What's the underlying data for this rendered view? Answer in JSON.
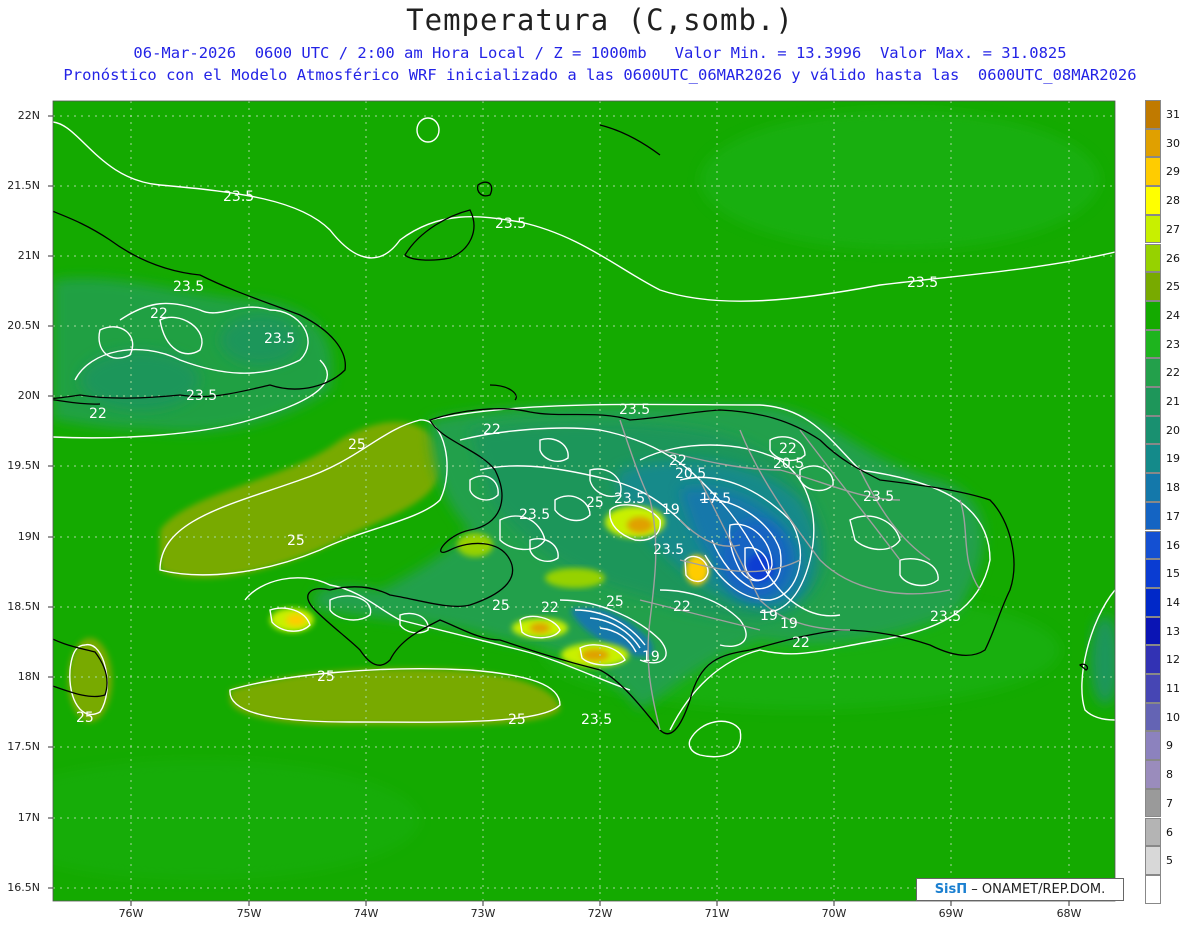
{
  "header": {
    "title": "Temperatura (C,somb.)",
    "line1": "06-Mar-2026  0600 UTC / 2:00 am Hora Local / Z = 1000mb   Valor Min. = 13.3996  Valor Max. = 31.0825",
    "line2": "Pronóstico con el Modelo Atmosférico WRF inicializado a las 0600UTC_06MAR2026 y válido hasta las  0600UTC_08MAR2026"
  },
  "axes": {
    "lat_labels": [
      "22N",
      "21.5N",
      "21N",
      "20.5N",
      "20N",
      "19.5N",
      "19N",
      "18.5N",
      "18N",
      "17.5N",
      "17N",
      "16.5N"
    ],
    "lon_labels": [
      "76W",
      "75W",
      "74W",
      "73W",
      "72W",
      "71W",
      "70W",
      "69W",
      "68W"
    ]
  },
  "colorbar": {
    "levels": [
      {
        "label": "31",
        "color": "#c07a00"
      },
      {
        "label": "30",
        "color": "#e0a000"
      },
      {
        "label": "29",
        "color": "#ffcc00"
      },
      {
        "label": "28",
        "color": "#ffff00"
      },
      {
        "label": "27",
        "color": "#c8f000"
      },
      {
        "label": "26",
        "color": "#96d200"
      },
      {
        "label": "25",
        "color": "#78aa00"
      },
      {
        "label": "24",
        "color": "#14aa00"
      },
      {
        "label": "23",
        "color": "#1eb41e"
      },
      {
        "label": "22",
        "color": "#23a04b"
      },
      {
        "label": "21",
        "color": "#1e965a"
      },
      {
        "label": "20",
        "color": "#199070"
      },
      {
        "label": "19",
        "color": "#148a8a"
      },
      {
        "label": "18",
        "color": "#1478aa"
      },
      {
        "label": "17",
        "color": "#1464c3"
      },
      {
        "label": "16",
        "color": "#1450d2"
      },
      {
        "label": "15",
        "color": "#0a3cd2"
      },
      {
        "label": "14",
        "color": "#0028c8"
      },
      {
        "label": "13",
        "color": "#0a14b4"
      },
      {
        "label": "12",
        "color": "#3232b4"
      },
      {
        "label": "11",
        "color": "#4646b4"
      },
      {
        "label": "10",
        "color": "#6464b4"
      },
      {
        "label": "9",
        "color": "#8c82be"
      },
      {
        "label": "8",
        "color": "#9a8cbc"
      },
      {
        "label": "7",
        "color": "#9a9a9a"
      },
      {
        "label": "6",
        "color": "#b4b4b4"
      },
      {
        "label": "5",
        "color": "#d8d8d8"
      },
      {
        "label": "",
        "color": "#ffffff"
      }
    ]
  },
  "contour_labels": [
    "23.5",
    "23.5",
    "23.5",
    "23.5",
    "22",
    "23.5",
    "22",
    "23.5",
    "22",
    "25",
    "25",
    "23.5",
    "22",
    "22",
    "20.5",
    "20.5",
    "25",
    "23.5",
    "17.5",
    "19",
    "23.5",
    "23.5",
    "25",
    "22",
    "25",
    "22",
    "19",
    "23.5",
    "19",
    "25",
    "25",
    "23.5",
    "25",
    "22",
    "19",
    "23.5"
  ],
  "credit": {
    "logo": "SisΠ",
    "text": "– ONAMET/REP.DOM."
  },
  "colors": {
    "ocean": "#14aa00",
    "land_high": "#78aa00",
    "hot": "#ffcc00",
    "cold": "#0a3cd2"
  }
}
